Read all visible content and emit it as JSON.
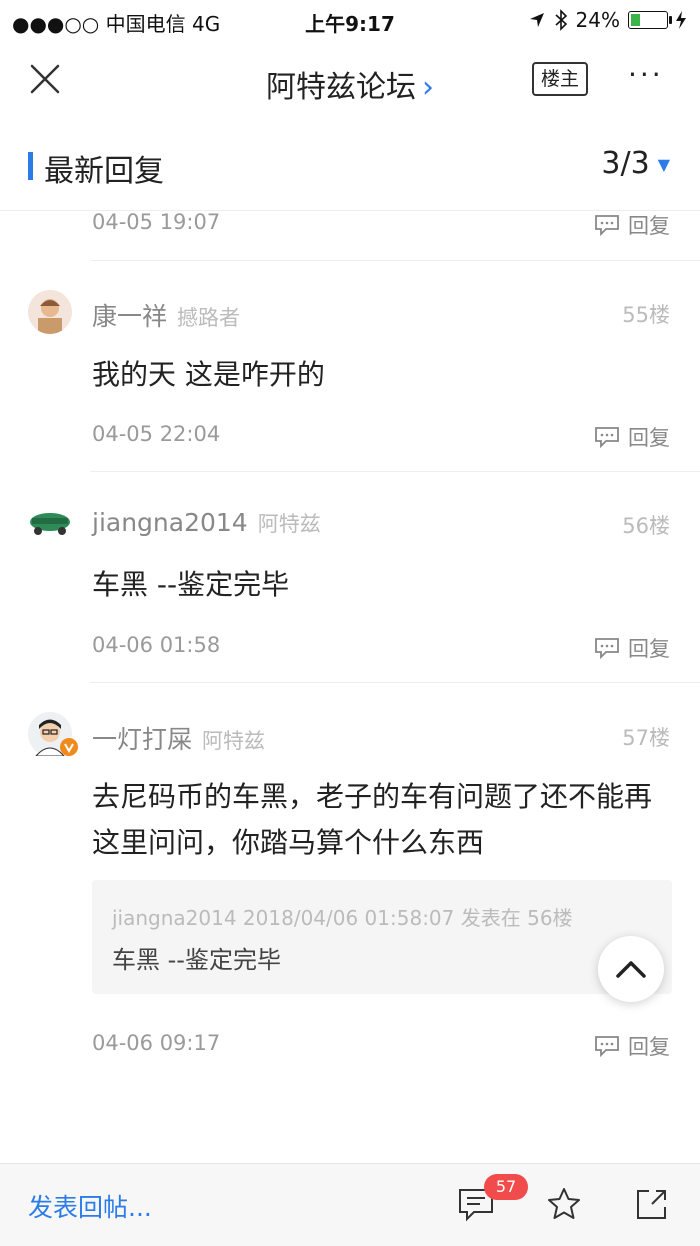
{
  "status_bar": {
    "carrier": "●●●○○ 中国电信  4G",
    "time": "上午9:17",
    "battery": "24%",
    "battery_level": 0.24
  },
  "nav": {
    "title": "阿特兹论坛",
    "louzhu_label": "楼主",
    "more": "···"
  },
  "section": {
    "title": "最新回复",
    "page": "3/3"
  },
  "top_item": {
    "time": "04-05 19:07",
    "reply_label": "回复"
  },
  "posts": [
    {
      "name": "康一祥",
      "tag": "撼路者",
      "floor": "55楼",
      "content": "我的天 这是咋开的",
      "time": "04-05 22:04",
      "reply_label": "回复"
    },
    {
      "name": "jiangna2014",
      "tag": "阿特兹",
      "floor": "56楼",
      "content": "车黑 --鉴定完毕",
      "time": "04-06 01:58",
      "reply_label": "回复"
    },
    {
      "name": "一灯打屎",
      "tag": "阿特兹",
      "floor": "57楼",
      "content": "去尼码币的车黑，老子的车有问题了还不能再这里问问，你踏马算个什么东西",
      "quote_meta": "jiangna2014 2018/04/06 01:58:07 发表在 56楼",
      "quote_text": "车黑 --鉴定完毕",
      "time": "04-06 09:17",
      "reply_label": "回复"
    }
  ],
  "bottom_bar": {
    "compose_label": "发表回帖...",
    "comment_count": "57"
  },
  "colors": {
    "accent": "#2b7ce9",
    "badge": "#f24b4b"
  }
}
